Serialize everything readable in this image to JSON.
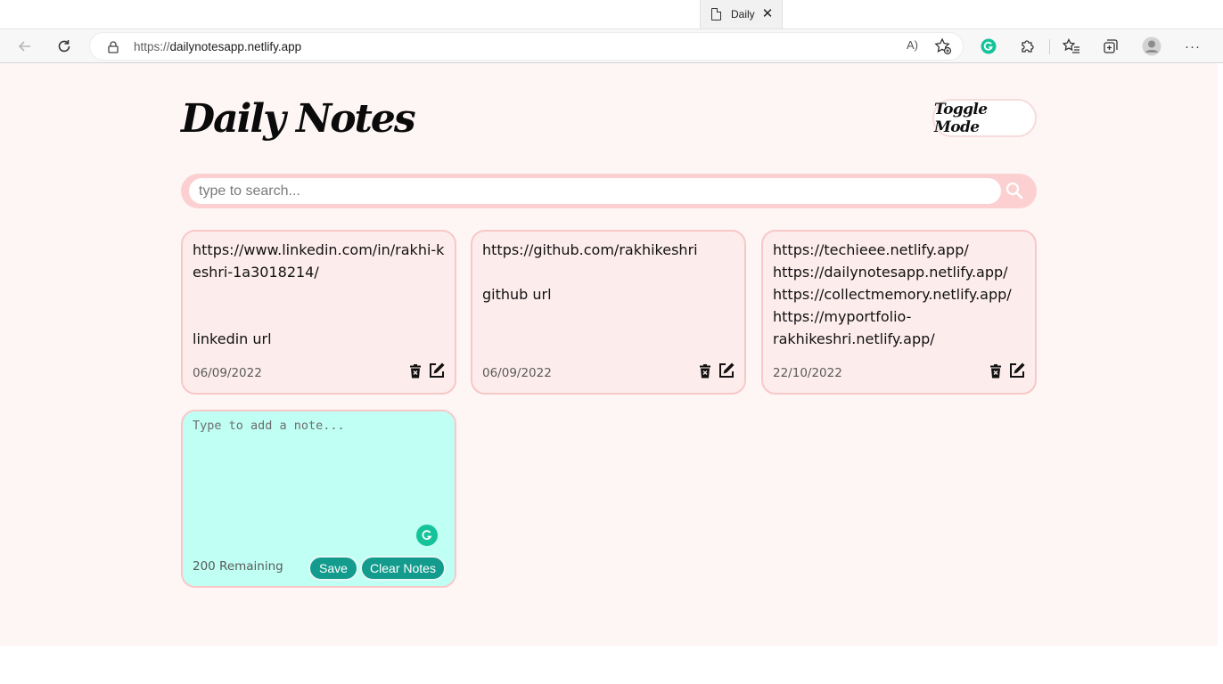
{
  "browser": {
    "tab_title": "Daily",
    "close_glyph": "✕",
    "url_prefix": "https://",
    "url_host": "dailynotesapp.netlify.app",
    "read_aloud_label": "A)",
    "more_glyph": "···"
  },
  "header": {
    "title": "Daily Notes",
    "toggle_label": "Toggle Mode"
  },
  "search": {
    "placeholder": "type to search...",
    "value": ""
  },
  "notes": [
    {
      "text": "https://www.linkedin.com/in/rakhi-keshri-1a3018214/\n\n\nlinkedin url",
      "date": "06/09/2022"
    },
    {
      "text": "https://github.com/rakhikeshri\n\ngithub url",
      "date": "06/09/2022"
    },
    {
      "text": "https://techieee.netlify.app/\nhttps://dailynotesapp.netlify.app/\nhttps://collectmemory.netlify.app/\nhttps://myportfolio-rakhikeshri.netlify.app/",
      "date": "22/10/2022"
    }
  ],
  "new_note": {
    "placeholder": "Type to add a note...",
    "remaining": "200 Remaining",
    "save_label": "Save",
    "clear_label": "Clear Notes"
  },
  "colors": {
    "page_bg": "#fef5f5",
    "note_bg": "#fdecec",
    "note_border": "#f8c8c8",
    "search_bar": "#fcd0d0",
    "new_note_bg": "#bffff4",
    "button": "#139c8d",
    "grammarly": "#15c39a"
  },
  "icons": {
    "search": "search-icon",
    "delete": "trash-icon",
    "edit": "edit-icon"
  }
}
